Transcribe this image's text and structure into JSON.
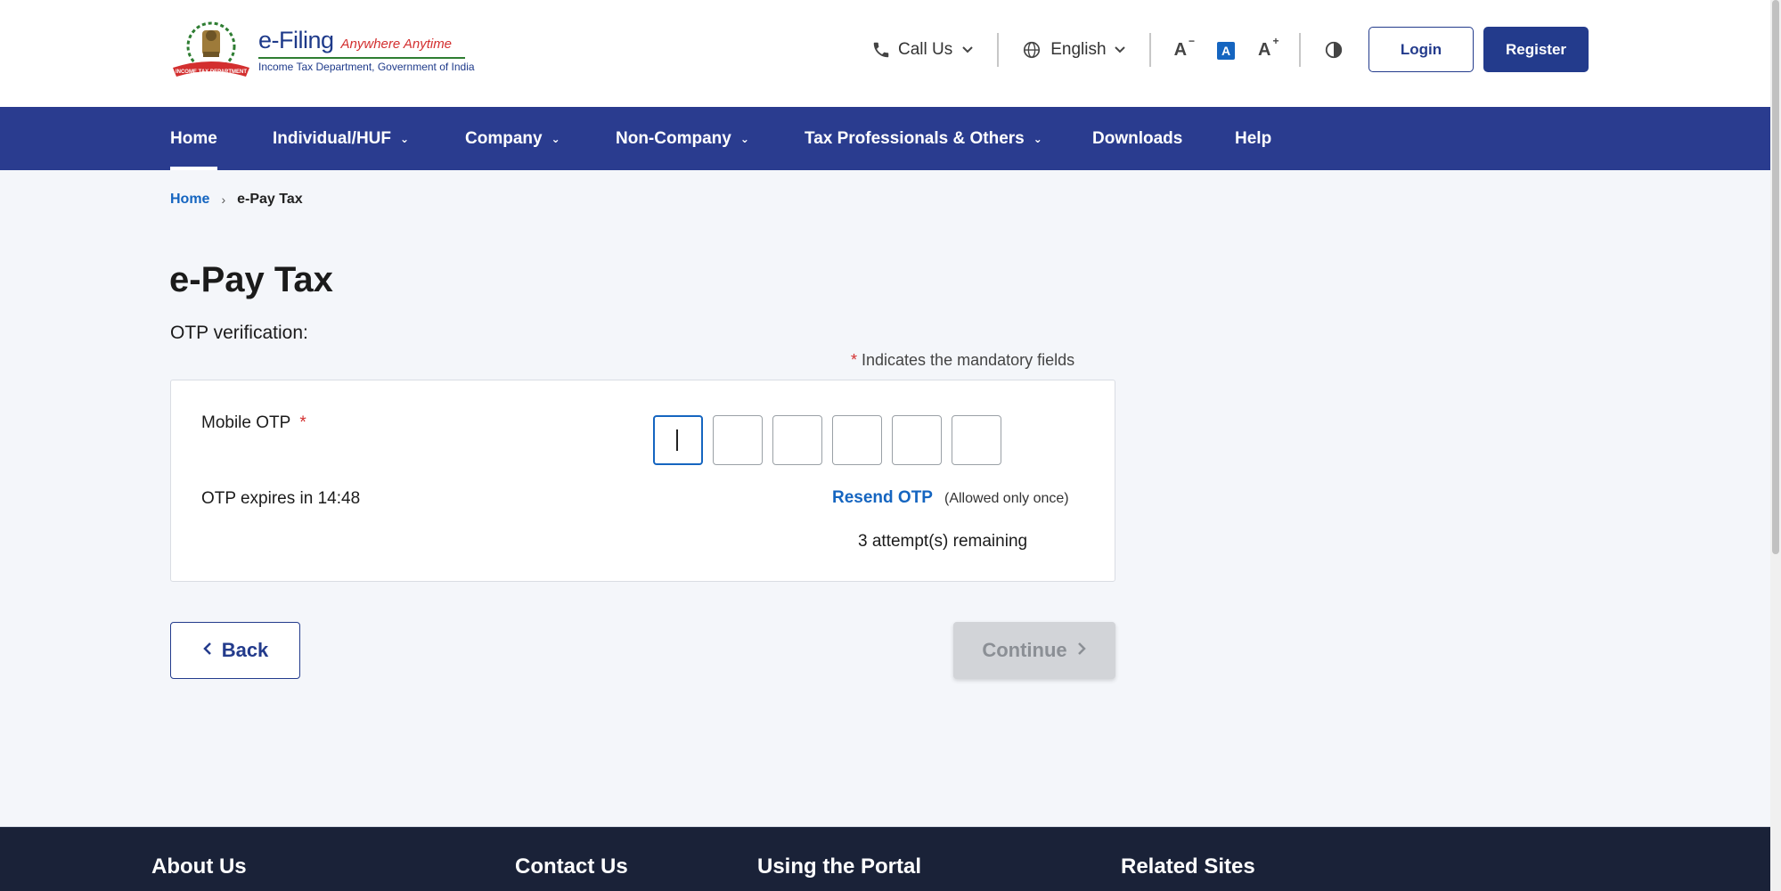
{
  "header": {
    "logo": {
      "efiling": "e-Filing",
      "tagline": "Anywhere Anytime",
      "department": "Income Tax Department, Government of India",
      "emblem_text": "INCOME TAX DEPARTMENT"
    },
    "call_us": "Call Us",
    "language": "English",
    "font_decrease": "A",
    "font_default": "A",
    "font_increase": "A",
    "login_label": "Login",
    "register_label": "Register"
  },
  "nav": {
    "items": [
      {
        "label": "Home",
        "has_dropdown": false,
        "active": true
      },
      {
        "label": "Individual/HUF",
        "has_dropdown": true
      },
      {
        "label": "Company",
        "has_dropdown": true
      },
      {
        "label": "Non-Company",
        "has_dropdown": true
      },
      {
        "label": "Tax Professionals & Others",
        "has_dropdown": true
      },
      {
        "label": "Downloads",
        "has_dropdown": false
      },
      {
        "label": "Help",
        "has_dropdown": false
      }
    ]
  },
  "breadcrumb": {
    "home": "Home",
    "current": "e-Pay Tax"
  },
  "page": {
    "title": "e-Pay Tax",
    "subtitle": "OTP verification:",
    "mandatory_note": "Indicates the mandatory fields",
    "required_mark": "*"
  },
  "otp": {
    "label": "Mobile OTP",
    "required_mark": "*",
    "digits": [
      "",
      "",
      "",
      "",
      "",
      ""
    ],
    "expires_text": "OTP expires in 14:48",
    "resend_label": "Resend OTP",
    "resend_note": "(Allowed only once)",
    "attempts_text": "3 attempt(s) remaining"
  },
  "actions": {
    "back_label": "Back",
    "continue_label": "Continue"
  },
  "footer": {
    "headings": [
      "About Us",
      "Contact Us",
      "Using the Portal",
      "Related Sites"
    ]
  },
  "colors": {
    "nav_bg": "#2a3c8f",
    "primary": "#233b8c",
    "link": "#1565c0",
    "required": "#d32f2f",
    "footer_bg": "#1a2238"
  }
}
